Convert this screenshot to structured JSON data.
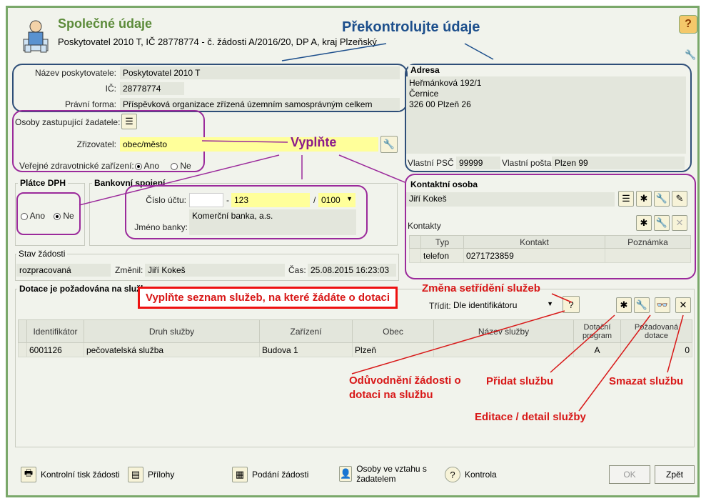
{
  "header": {
    "title": "Společné údaje",
    "subtitle": "Poskytovatel 2010 T, IČ 28778774 - č. žádosti A/2016/20, DP A, kraj Plzeňský"
  },
  "annotations": {
    "check": "Překontrolujte údaje",
    "fill": "Vyplňte",
    "fill_services": "Vyplňte seznam služeb, na které žádáte o dotaci",
    "sort_change": "Změna setřídění služeb",
    "justification": "Odůvodnění žádosti o dotaci na službu",
    "add_service": "Přidat službu",
    "delete_service": "Smazat službu",
    "edit_service": "Editace / detail služby"
  },
  "provider": {
    "name_label": "Název poskytovatele:",
    "name_value": "Poskytovatel 2010 T",
    "ic_label": "IČ:",
    "ic_value": "28778774",
    "legal_label": "Právní forma:",
    "legal_value": "Příspěvková organizace zřízená územním samosprávným celkem"
  },
  "address": {
    "title": "Adresa",
    "line1": "Heřmánková 192/1",
    "line2": "Černice",
    "line3": "326 00 Plzeň 26",
    "psc_label": "Vlastní PSČ",
    "psc_value": "99999",
    "post_label": "Vlastní pošta",
    "post_value": "Plzen 99"
  },
  "representatives": {
    "persons_label": "Osoby zastupující žadatele:",
    "founder_label": "Zřizovatel:",
    "founder_value": "obec/město",
    "health_label": "Veřejné zdravotnické zařízení:",
    "yes": "Ano",
    "no": "Ne"
  },
  "vat": {
    "title": "Plátce DPH",
    "yes": "Ano",
    "no": "Ne"
  },
  "bank": {
    "title": "Bankovní spojení",
    "account_label": "Číslo účtu:",
    "prefix": "",
    "dash": "-",
    "account": "123",
    "slash": "/",
    "code": "0100",
    "bank_label": "Jméno banky:",
    "bank_value": "Komerční banka, a.s."
  },
  "contact": {
    "title": "Kontaktní osoba",
    "name": "Jiří Kokeš",
    "contacts_label": "Kontakty",
    "headers": [
      "Typ",
      "Kontakt",
      "Poznámka"
    ],
    "rows": [
      [
        "telefon",
        "0271723859",
        ""
      ]
    ]
  },
  "status": {
    "title": "Stav žádosti",
    "state": "rozpracovaná",
    "changed_label": "Změnil:",
    "changed_value": "Jiří Kokeš",
    "time_label": "Čas:",
    "time_value": "25.08.2015 16:23:03"
  },
  "services": {
    "title": "Dotace je požadována na služby",
    "sort_label": "Třídit:",
    "sort_value": "Dle identifikátoru",
    "headers": [
      "Identifikátor",
      "Druh služby",
      "Zařízení",
      "Obec",
      "Název služby",
      "Dotační program",
      "Požadovaná dotace"
    ],
    "rows": [
      [
        "6001126",
        "pečovatelská služba",
        "Budova 1",
        "Plzeň",
        "",
        "A",
        "0"
      ]
    ]
  },
  "footer": {
    "print": "Kontrolní tisk žádosti",
    "attachments": "Přílohy",
    "submit": "Podání žádosti",
    "persons_rel": "Osoby ve vztahu s žadatelem",
    "control": "Kontrola",
    "ok": "OK",
    "back": "Zpět"
  }
}
